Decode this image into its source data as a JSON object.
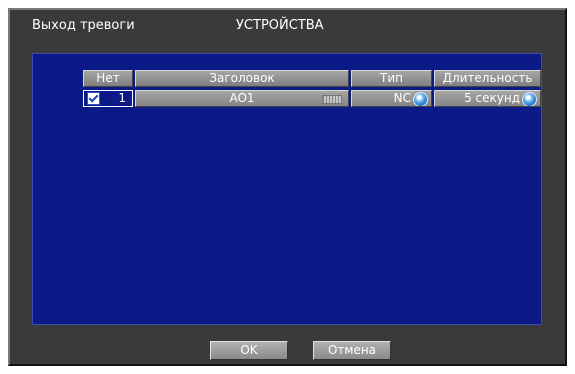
{
  "window": {
    "title_left": "Выход тревоги",
    "title_center": "УСТРОЙСТВА"
  },
  "table": {
    "headers": [
      "Нет",
      "Заголовок",
      "Тип",
      "Длительность"
    ],
    "rows": [
      {
        "checked": true,
        "no": "1",
        "title": "AO1",
        "type": "NC",
        "duration": "5 секунд"
      }
    ]
  },
  "icons": {
    "checkbox": "checkbox-checked-icon",
    "keyboard": "keyboard-icon",
    "spinner": "dropdown-spin-icon"
  },
  "footer": {
    "ok_label": "OK",
    "cancel_label": "Отмена"
  },
  "colors": {
    "panel": "#0c1a88",
    "window": "#3a3a3a",
    "button": "#9a9a9a"
  }
}
